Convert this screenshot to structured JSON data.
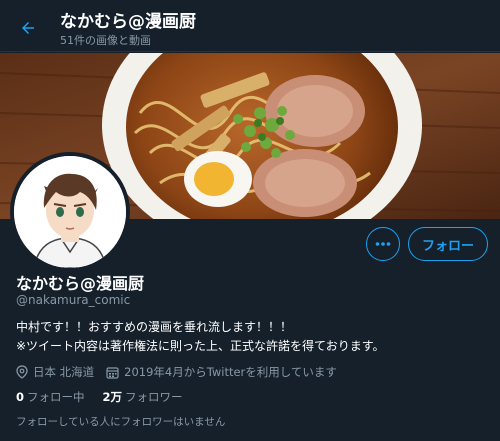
{
  "header": {
    "back_icon": "arrow-left-icon",
    "name": "なかむら@漫画厨",
    "subtitle": "51件の画像と動画"
  },
  "banner": {
    "image": "ramen-bowl-photo"
  },
  "profile": {
    "avatar": "anime-style-avatar",
    "more_icon": "ellipsis-icon",
    "follow_label": "フォロー",
    "display_name": "なかむら@漫画厨",
    "handle": "@nakamura_comic",
    "bio_line1": "中村です！！おすすめの漫画を垂れ流します！！！",
    "bio_line2": "※ツイート内容は著作権法に則った上、正式な許諾を得ております。",
    "location_icon": "location-pin-icon",
    "location": "日本 北海道",
    "joined_icon": "calendar-icon",
    "joined": "2019年4月からTwitterを利用しています",
    "following_count": "0",
    "following_label": "フォロー中",
    "followers_count": "2万",
    "followers_label": "フォロワー",
    "followers_you_know": "フォローしている人にフォロワーはいません"
  },
  "colors": {
    "background": "#15202b",
    "accent": "#1da1f2",
    "secondary_text": "#8899a6"
  }
}
